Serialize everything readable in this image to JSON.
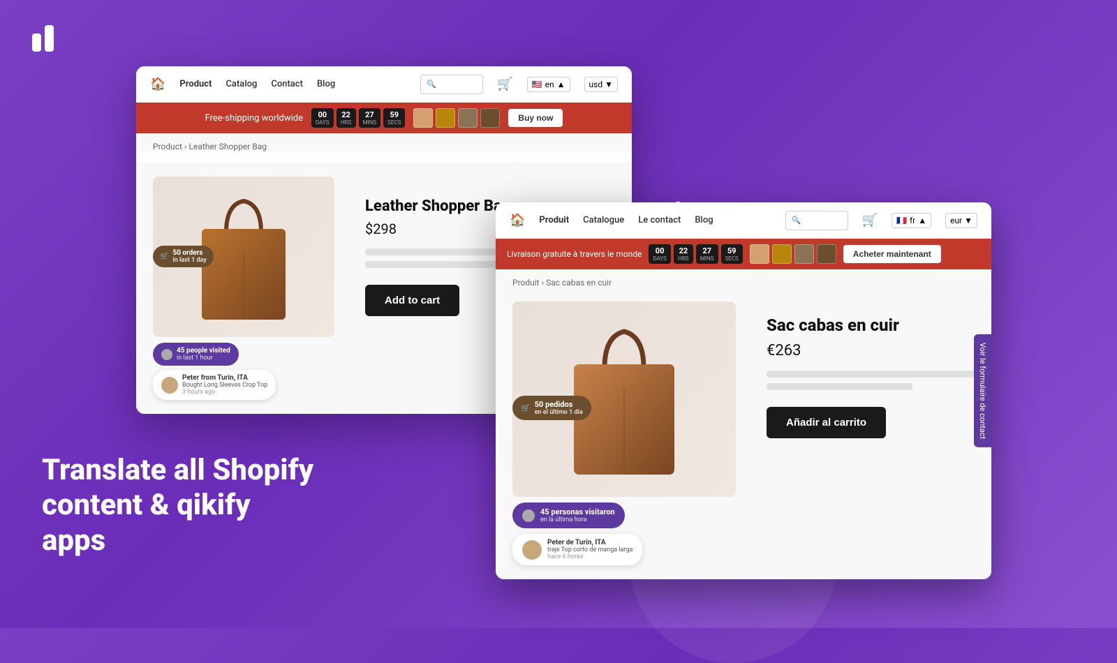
{
  "logo": {
    "icon_label": "qikify logo"
  },
  "hero": {
    "line1": "Translate all Shopify",
    "line2": "content & qikify apps"
  },
  "arrow": {
    "label": "dashed arrow"
  },
  "en_window": {
    "nav": {
      "home_label": "🏠",
      "product": "Product",
      "catalog": "Catalog",
      "contact": "Contact",
      "blog": "Blog",
      "search_placeholder": "Search",
      "language": "en",
      "currency": "usd"
    },
    "banner": {
      "text": "Free-shipping worldwide",
      "timer": {
        "days": "00",
        "hours": "22",
        "mins": "27",
        "secs": "59"
      },
      "buy_now": "Buy now"
    },
    "breadcrumb": "Product › Leather Shopper Bag",
    "product": {
      "title": "Leather Shopper Bag",
      "price": "$298",
      "add_to_cart": "Add to cart"
    },
    "badges": {
      "orders": "50 orders",
      "orders_sub": "in last 1 day",
      "visited": "45 people visited",
      "visited_sub": "in last 1 hour",
      "recent_name": "Peter from Turin, ITA",
      "recent_item": "Bought Long Sleeves Crop Top",
      "recent_time": "3 hours ago"
    }
  },
  "fr_window": {
    "nav": {
      "home_label": "🏠",
      "product": "Produit",
      "catalog": "Catalogue",
      "contact": "Le contact",
      "blog": "Blog",
      "search_placeholder": "Recherche",
      "language": "fr",
      "currency": "eur"
    },
    "banner": {
      "text": "Livraison gratuite à travers le monde",
      "timer": {
        "days": "00",
        "hours": "22",
        "mins": "27",
        "secs": "59"
      },
      "buy_now": "Acheter maintenant"
    },
    "breadcrumb": "Produit › Sac cabas en cuir",
    "product": {
      "title": "Sac cabas en cuir",
      "price": "€263",
      "add_to_cart": "Añadir al carrito"
    },
    "badges": {
      "orders": "50 pedidos",
      "orders_sub": "en el último 1 día",
      "visited": "45 personas visitaron",
      "visited_sub": "en la última hora",
      "recent_name": "Peter de Turín, ITA",
      "recent_item": "traje Top corto de manga larga",
      "recent_time": "hace 6 horas"
    },
    "contact_sidebar": "Voir le formulaire de contact"
  }
}
